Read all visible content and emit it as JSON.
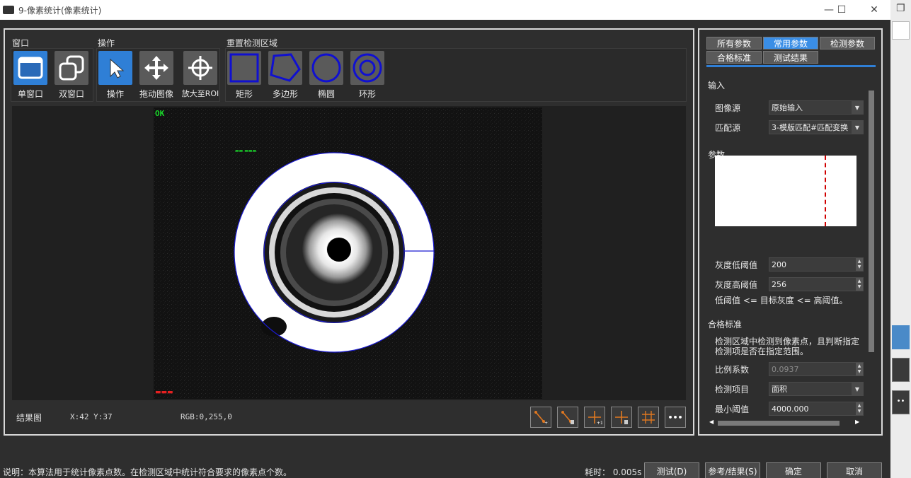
{
  "window": {
    "title": "9-像素统计(像素统计)",
    "minimize": "—",
    "maximize": "☐",
    "close": "✕"
  },
  "toolbar": {
    "window_group": "窗口",
    "operation_group": "操作",
    "roi_group": "重置检测区域",
    "single_window": "单窗口",
    "dual_window": "双窗口",
    "operate": "操作",
    "drag_image": "拖动图像",
    "zoom_roi": "放大至ROI",
    "rect": "矩形",
    "polygon": "多边形",
    "ellipse": "椭圆",
    "ring": "环形"
  },
  "viewer": {
    "ok_text": "OK",
    "result_label": "结果图",
    "xy": "X:42 Y:37",
    "rgb": "RGB:0,255,0",
    "more": "•••"
  },
  "tabs": [
    "所有参数",
    "常用参数",
    "检测参数",
    "合格标准",
    "测试结果"
  ],
  "params": {
    "input_section": "输入",
    "image_source_label": "图像源",
    "image_source_value": "原始输入",
    "match_source_label": "匹配源",
    "match_source_value": "3-模版匹配#匹配变换",
    "param_section": "参数",
    "gray_low_label": "灰度低阈值",
    "gray_low_value": "200",
    "gray_high_label": "灰度高阈值",
    "gray_high_value": "256",
    "threshold_note": "低阈值 <= 目标灰度 <= 高阈值。",
    "criteria_section": "合格标准",
    "criteria_note": "检测区域中检测到像素点，且判断指定检测项是否在指定范围。",
    "ratio_label": "比例系数",
    "ratio_value": "0.0937",
    "item_label": "检测项目",
    "item_value": "面积",
    "min_label": "最小阈值",
    "min_value": "4000.000"
  },
  "footer": {
    "description": "说明：本算法用于统计像素点数。在检测区域中统计符合要求的像素点个数。",
    "elapsed": "耗时： 0.005s",
    "test_btn": "测试(D)",
    "ref_btn": "参考/结果(S)",
    "ok_btn": "确定",
    "cancel_btn": "取消"
  },
  "colors": {
    "accent": "#2f7fd6",
    "ok_green": "#19d82a",
    "roi_blue": "#1010d0"
  }
}
